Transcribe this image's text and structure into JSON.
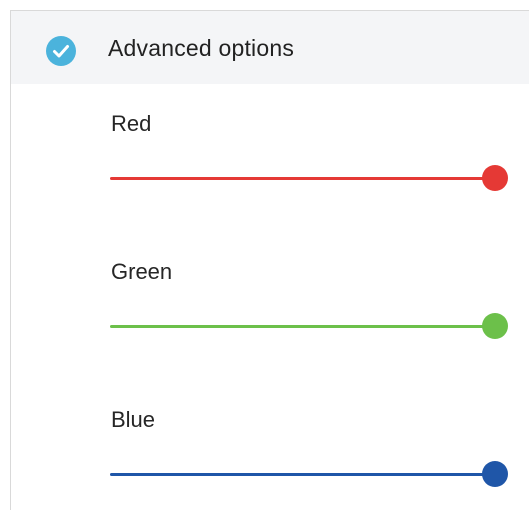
{
  "section": {
    "title": "Advanced options",
    "icon": "check-circle-icon",
    "checked": true,
    "accent": "#4bb3dc"
  },
  "sliders": [
    {
      "label": "Red",
      "value": 1.0,
      "color": "#e53935"
    },
    {
      "label": "Green",
      "value": 1.0,
      "color": "#6cc04a"
    },
    {
      "label": "Blue",
      "value": 1.0,
      "color": "#1f56a8"
    }
  ]
}
